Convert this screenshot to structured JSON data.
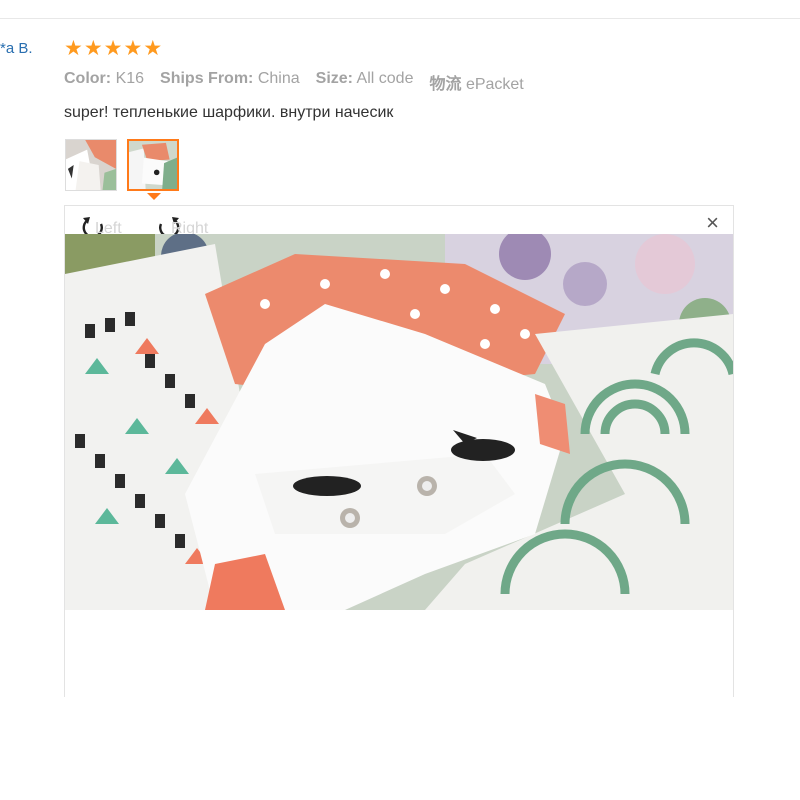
{
  "review": {
    "reviewer_name": "*a B.",
    "rating": 5,
    "attributes": [
      {
        "key": "Color:",
        "value": "K16"
      },
      {
        "key": "Ships From:",
        "value": "China"
      },
      {
        "key": "Size:",
        "value": "All code"
      },
      {
        "key": "物流",
        "value": "ePacket"
      }
    ],
    "comment": "super! тепленькие шарфики. внутри начесик"
  },
  "viewer": {
    "rotate_left_label": "Left",
    "rotate_right_label": "Right",
    "close_symbol": "×",
    "active_thumbnail_index": 1
  },
  "colors": {
    "star": "#ff9a1f",
    "active_border": "#ff7a1a",
    "reviewer_link": "#2a6fb0"
  }
}
